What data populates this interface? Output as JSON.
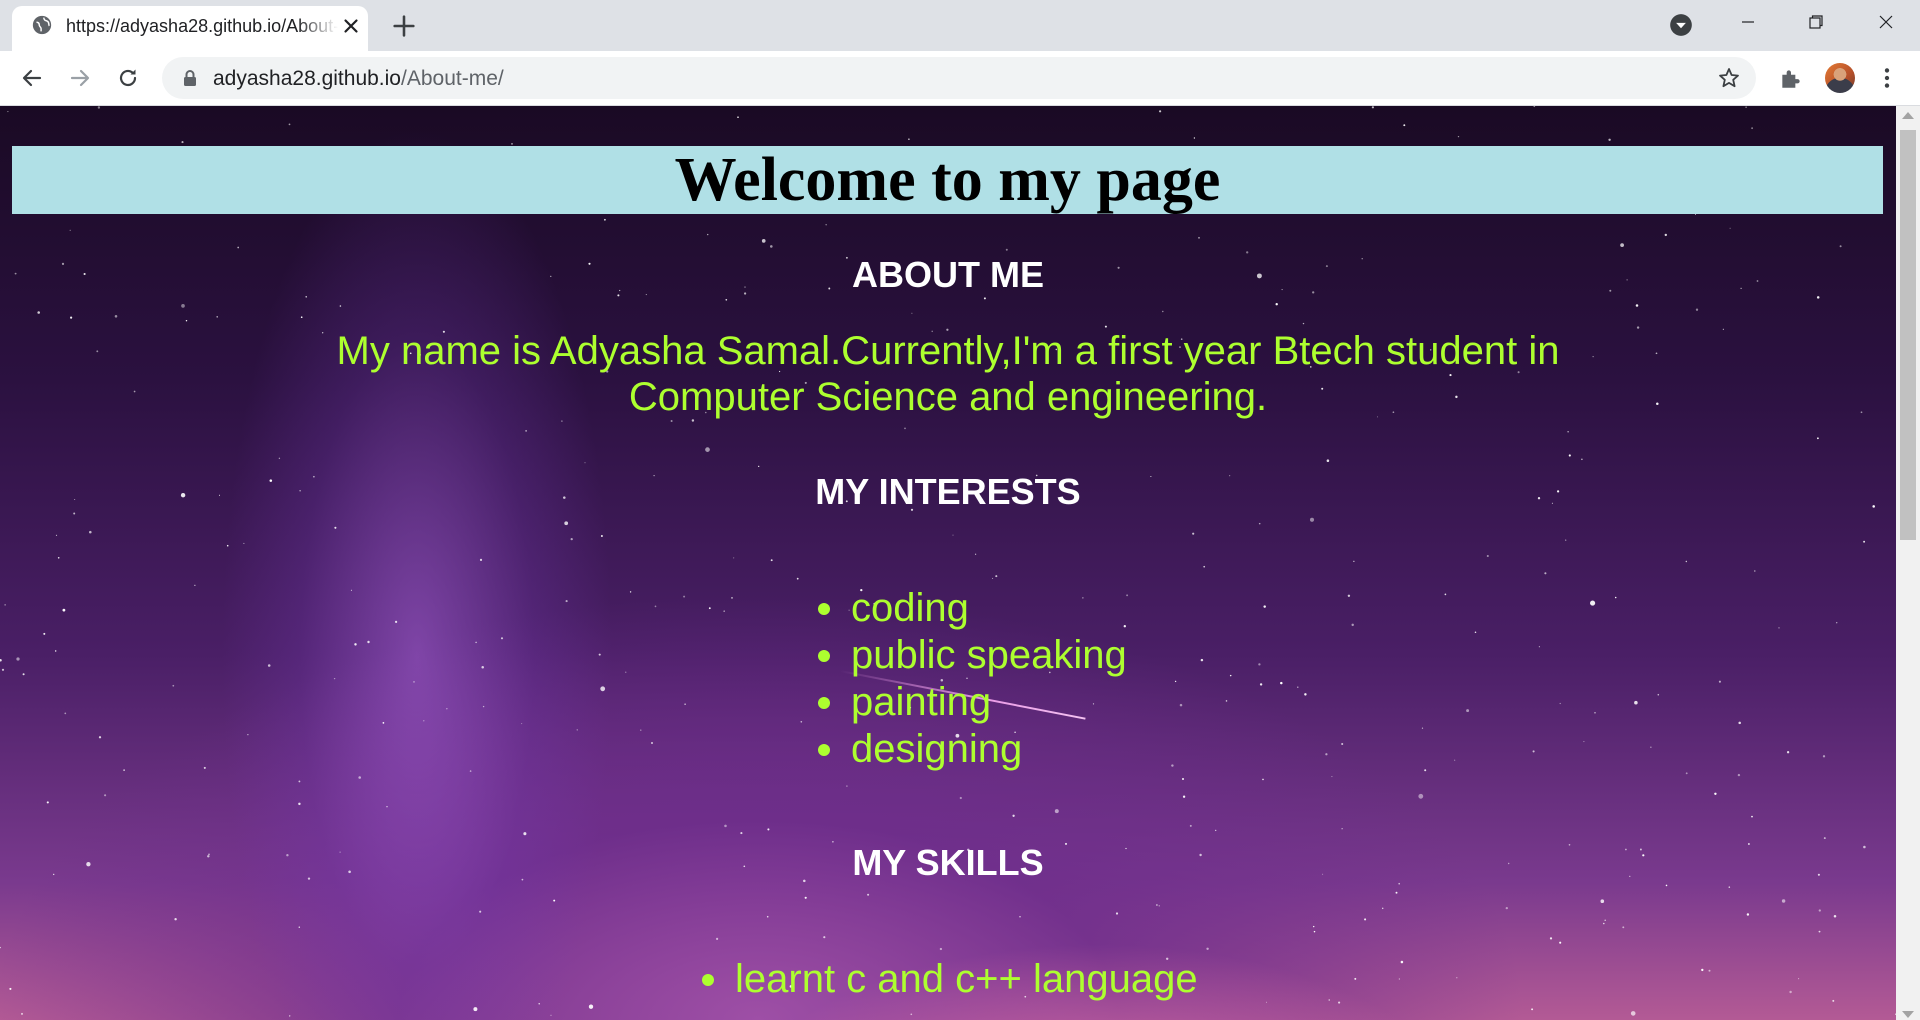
{
  "browser": {
    "tab": {
      "title": "https://adyasha28.github.io/About-me/",
      "favicon": "globe-icon",
      "close_icon": "close-icon"
    },
    "new_tab_icon": "plus-icon",
    "tab_search_icon": "chevron-down-circle-icon",
    "window_controls": [
      "minimize-icon",
      "restore-icon",
      "close-icon"
    ],
    "toolbar": {
      "back_icon": "arrow-left-icon",
      "forward_icon": "arrow-right-icon",
      "reload_icon": "reload-icon",
      "url_host": "adyasha28.github.io",
      "url_path": "/About-me/",
      "lock_icon": "lock-icon",
      "bookmark_icon": "star-icon",
      "extensions_icon": "puzzle-icon",
      "menu_icon": "kebab-menu-icon"
    }
  },
  "page": {
    "welcome_title": "Welcome to my page",
    "about": {
      "heading": "ABOUT ME",
      "text": "My name is Adyasha Samal.Currently,I'm a first year Btech student in Computer Science and engineering."
    },
    "interests": {
      "heading": "MY INTERESTS",
      "items": [
        "coding",
        "public speaking",
        "painting",
        "designing"
      ]
    },
    "skills": {
      "heading": "MY SKILLS",
      "items": [
        "learnt c and c++ language"
      ]
    }
  },
  "colors": {
    "header_bg": "#b0e0e6",
    "body_text": "#adff2f",
    "heading_text": "#ffffff"
  }
}
